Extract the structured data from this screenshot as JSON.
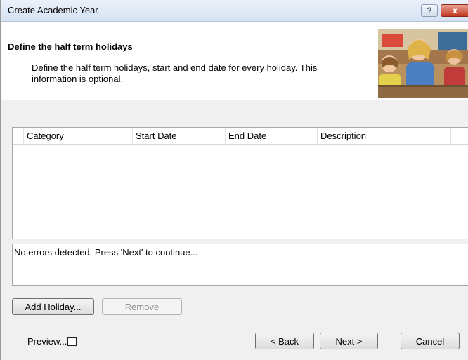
{
  "window": {
    "title": "Create Academic Year",
    "help_label": "?",
    "close_label": "x"
  },
  "header": {
    "title": "Define the half term holidays",
    "description": "Define the half term holidays, start and end date for every holiday. This information is optional."
  },
  "table": {
    "columns": [
      "Category",
      "Start Date",
      "End Date",
      "Description"
    ],
    "rows": []
  },
  "status": {
    "message": "No errors detected. Press 'Next' to continue..."
  },
  "actions": {
    "add_holiday": "Add Holiday...",
    "remove": "Remove"
  },
  "footer": {
    "preview_label": "Preview...",
    "preview_checked": false,
    "back": "< Back",
    "next": "Next >",
    "cancel": "Cancel"
  },
  "colors": {
    "titlebar": "#dbe6f4",
    "close_button": "#c13a22",
    "dialog_background": "#f0f0f0"
  }
}
